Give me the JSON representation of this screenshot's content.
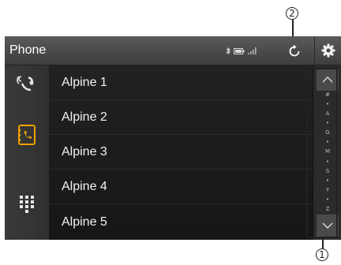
{
  "callouts": {
    "refresh": "2",
    "scrollbar": "1"
  },
  "header": {
    "title": "Phone"
  },
  "sidebar": {
    "items": [
      {
        "icon": "call-history-icon"
      },
      {
        "icon": "phonebook-icon",
        "active": true
      },
      {
        "icon": "dialpad-icon"
      }
    ]
  },
  "contacts": [
    {
      "name": "Alpine 1"
    },
    {
      "name": "Alpine 2"
    },
    {
      "name": "Alpine 3"
    },
    {
      "name": "Alpine 4"
    },
    {
      "name": "Alpine 5"
    }
  ],
  "index_letters": [
    "#",
    "•",
    "A",
    "•",
    "G",
    "•",
    "M",
    "•",
    "S",
    "•",
    "Y",
    "•",
    "Z"
  ],
  "colors": {
    "accent": "#f0a000",
    "background": "#1a1a1a"
  }
}
